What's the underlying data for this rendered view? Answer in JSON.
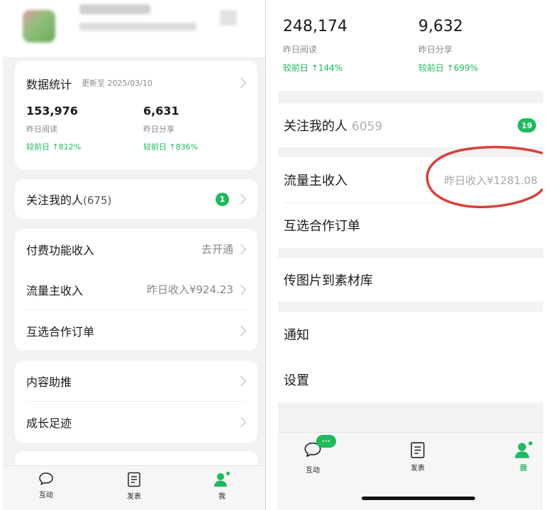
{
  "left": {
    "stats": {
      "title": "数据统计",
      "updated": "更新至 2025/03/10",
      "items": [
        {
          "value": "153,976",
          "label": "昨日阅读",
          "change": "较前日 ↑812%"
        },
        {
          "value": "6,631",
          "label": "昨日分享",
          "change": "较前日 ↑836%"
        }
      ]
    },
    "followers": {
      "label": "关注我的人",
      "count": "(675)",
      "badge": "1"
    },
    "paid": {
      "label": "付费功能收入",
      "value": "去开通"
    },
    "traffic": {
      "label": "流量主收入",
      "value": "昨日收入¥924.23"
    },
    "mutual": {
      "label": "互选合作订单"
    },
    "promo": {
      "label": "内容助推"
    },
    "growth": {
      "label": "成长足迹"
    },
    "tabs": [
      {
        "label": "互动",
        "icon": "chat-icon"
      },
      {
        "label": "发表",
        "icon": "document-icon"
      },
      {
        "label": "我",
        "icon": "person-icon"
      }
    ]
  },
  "right": {
    "stats": [
      {
        "value": "248,174",
        "label": "昨日阅读",
        "change": "较前日 ↑144%"
      },
      {
        "value": "9,632",
        "label": "昨日分享",
        "change": "较前日 ↑699%"
      }
    ],
    "followers": {
      "label": "关注我的人",
      "count": "6059",
      "badge": "19"
    },
    "traffic": {
      "label": "流量主收入",
      "value": "昨日收入¥1281.08"
    },
    "mutual": {
      "label": "互选合作订单"
    },
    "upload": {
      "label": "传图片到素材库"
    },
    "notify": {
      "label": "通知"
    },
    "settings": {
      "label": "设置"
    },
    "tabs": [
      {
        "label": "互动",
        "icon": "chat-icon",
        "badge": "···"
      },
      {
        "label": "发表",
        "icon": "document-icon"
      },
      {
        "label": "我",
        "icon": "person-icon"
      }
    ]
  },
  "colors": {
    "accent": "#1eba5c",
    "annotation": "#d9403a"
  }
}
